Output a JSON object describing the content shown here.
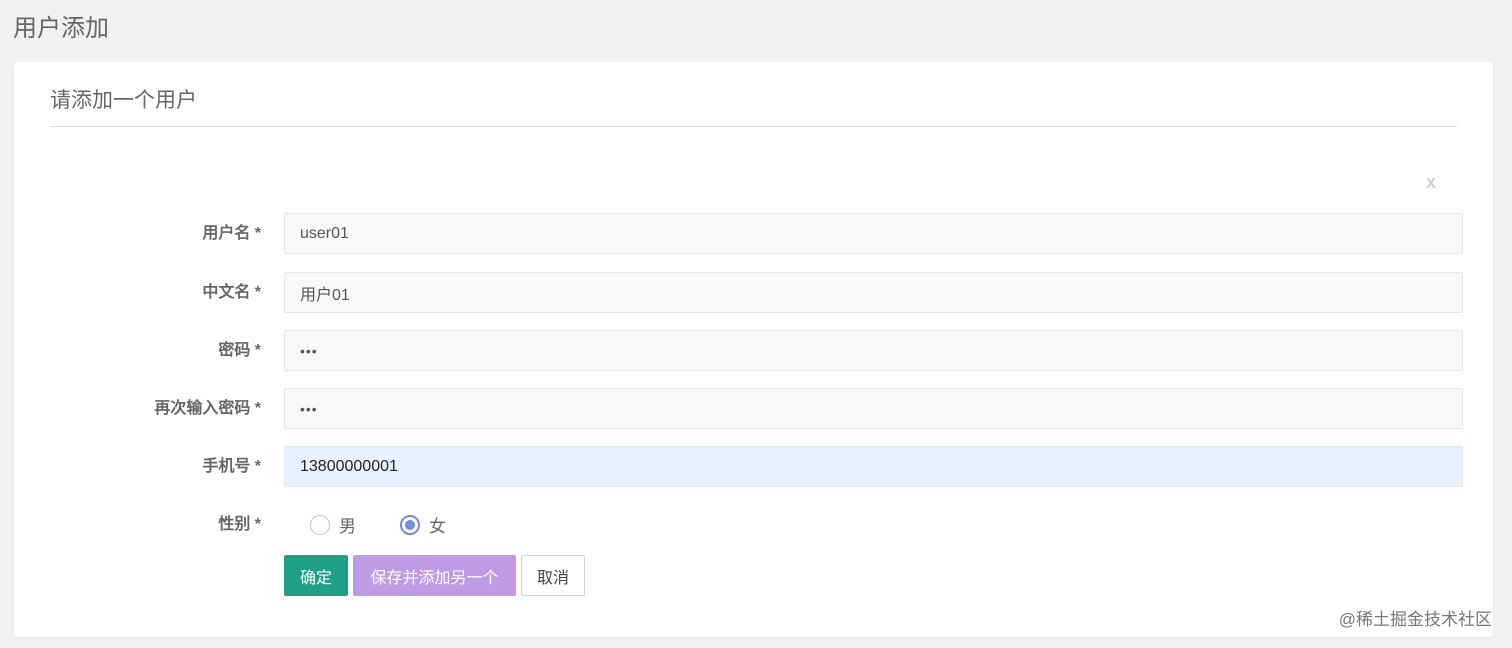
{
  "page": {
    "title": "用户添加"
  },
  "panel": {
    "heading": "请添加一个用户",
    "close_label": "x"
  },
  "form": {
    "username": {
      "label": "用户名 *",
      "value": "user01"
    },
    "chinese_name": {
      "label": "中文名 *",
      "value": "用户01"
    },
    "password": {
      "label": "密码 *",
      "value": "•••"
    },
    "confirm_password": {
      "label": "再次输入密码 *",
      "value": "•••"
    },
    "phone": {
      "label": "手机号 *",
      "value": "13800000001"
    },
    "gender": {
      "label": "性别 *",
      "options": [
        {
          "label": "男",
          "checked": false
        },
        {
          "label": "女",
          "checked": true
        }
      ]
    }
  },
  "buttons": {
    "confirm": "确定",
    "save_add_another": "保存并添加另一个",
    "cancel": "取消"
  },
  "colors": {
    "confirm_bg": "#1fa086",
    "save_add_bg": "#c09ae4",
    "radio_accent": "#6d8ed8",
    "focused_input_bg": "#e9f0fd"
  },
  "watermark": "@稀土掘金技术社区"
}
